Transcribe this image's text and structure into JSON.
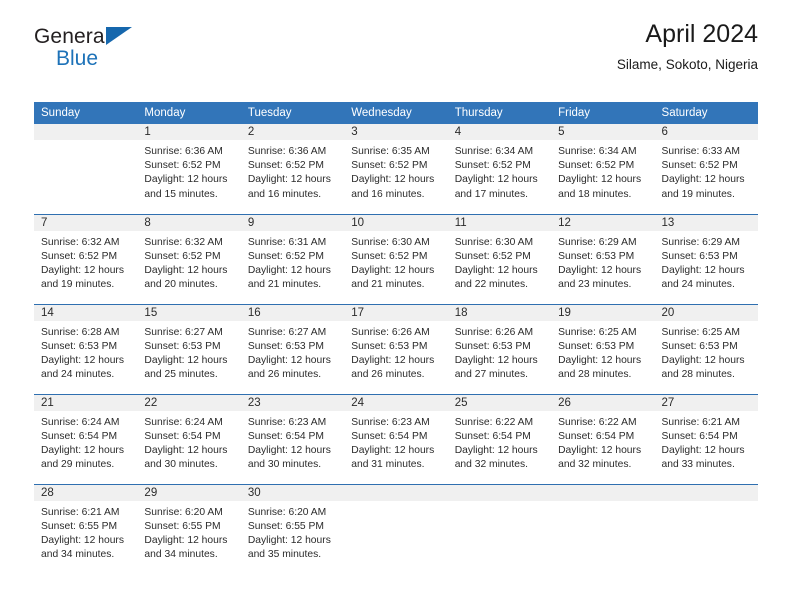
{
  "branding": {
    "logo_text_primary": "General",
    "logo_text_secondary": "Blue",
    "logo_icon": "triangle-icon",
    "accent_color": "#3275b9",
    "logo_blue": "#1d72b8"
  },
  "header": {
    "title": "April 2024",
    "subtitle": "Silame, Sokoto, Nigeria"
  },
  "calendar": {
    "weekday_headers": [
      "Sunday",
      "Monday",
      "Tuesday",
      "Wednesday",
      "Thursday",
      "Friday",
      "Saturday"
    ],
    "weeks": [
      [
        {
          "day": "",
          "lines": []
        },
        {
          "day": "1",
          "lines": [
            "Sunrise: 6:36 AM",
            "Sunset: 6:52 PM",
            "Daylight: 12 hours",
            "and 15 minutes."
          ]
        },
        {
          "day": "2",
          "lines": [
            "Sunrise: 6:36 AM",
            "Sunset: 6:52 PM",
            "Daylight: 12 hours",
            "and 16 minutes."
          ]
        },
        {
          "day": "3",
          "lines": [
            "Sunrise: 6:35 AM",
            "Sunset: 6:52 PM",
            "Daylight: 12 hours",
            "and 16 minutes."
          ]
        },
        {
          "day": "4",
          "lines": [
            "Sunrise: 6:34 AM",
            "Sunset: 6:52 PM",
            "Daylight: 12 hours",
            "and 17 minutes."
          ]
        },
        {
          "day": "5",
          "lines": [
            "Sunrise: 6:34 AM",
            "Sunset: 6:52 PM",
            "Daylight: 12 hours",
            "and 18 minutes."
          ]
        },
        {
          "day": "6",
          "lines": [
            "Sunrise: 6:33 AM",
            "Sunset: 6:52 PM",
            "Daylight: 12 hours",
            "and 19 minutes."
          ]
        }
      ],
      [
        {
          "day": "7",
          "lines": [
            "Sunrise: 6:32 AM",
            "Sunset: 6:52 PM",
            "Daylight: 12 hours",
            "and 19 minutes."
          ]
        },
        {
          "day": "8",
          "lines": [
            "Sunrise: 6:32 AM",
            "Sunset: 6:52 PM",
            "Daylight: 12 hours",
            "and 20 minutes."
          ]
        },
        {
          "day": "9",
          "lines": [
            "Sunrise: 6:31 AM",
            "Sunset: 6:52 PM",
            "Daylight: 12 hours",
            "and 21 minutes."
          ]
        },
        {
          "day": "10",
          "lines": [
            "Sunrise: 6:30 AM",
            "Sunset: 6:52 PM",
            "Daylight: 12 hours",
            "and 21 minutes."
          ]
        },
        {
          "day": "11",
          "lines": [
            "Sunrise: 6:30 AM",
            "Sunset: 6:52 PM",
            "Daylight: 12 hours",
            "and 22 minutes."
          ]
        },
        {
          "day": "12",
          "lines": [
            "Sunrise: 6:29 AM",
            "Sunset: 6:53 PM",
            "Daylight: 12 hours",
            "and 23 minutes."
          ]
        },
        {
          "day": "13",
          "lines": [
            "Sunrise: 6:29 AM",
            "Sunset: 6:53 PM",
            "Daylight: 12 hours",
            "and 24 minutes."
          ]
        }
      ],
      [
        {
          "day": "14",
          "lines": [
            "Sunrise: 6:28 AM",
            "Sunset: 6:53 PM",
            "Daylight: 12 hours",
            "and 24 minutes."
          ]
        },
        {
          "day": "15",
          "lines": [
            "Sunrise: 6:27 AM",
            "Sunset: 6:53 PM",
            "Daylight: 12 hours",
            "and 25 minutes."
          ]
        },
        {
          "day": "16",
          "lines": [
            "Sunrise: 6:27 AM",
            "Sunset: 6:53 PM",
            "Daylight: 12 hours",
            "and 26 minutes."
          ]
        },
        {
          "day": "17",
          "lines": [
            "Sunrise: 6:26 AM",
            "Sunset: 6:53 PM",
            "Daylight: 12 hours",
            "and 26 minutes."
          ]
        },
        {
          "day": "18",
          "lines": [
            "Sunrise: 6:26 AM",
            "Sunset: 6:53 PM",
            "Daylight: 12 hours",
            "and 27 minutes."
          ]
        },
        {
          "day": "19",
          "lines": [
            "Sunrise: 6:25 AM",
            "Sunset: 6:53 PM",
            "Daylight: 12 hours",
            "and 28 minutes."
          ]
        },
        {
          "day": "20",
          "lines": [
            "Sunrise: 6:25 AM",
            "Sunset: 6:53 PM",
            "Daylight: 12 hours",
            "and 28 minutes."
          ]
        }
      ],
      [
        {
          "day": "21",
          "lines": [
            "Sunrise: 6:24 AM",
            "Sunset: 6:54 PM",
            "Daylight: 12 hours",
            "and 29 minutes."
          ]
        },
        {
          "day": "22",
          "lines": [
            "Sunrise: 6:24 AM",
            "Sunset: 6:54 PM",
            "Daylight: 12 hours",
            "and 30 minutes."
          ]
        },
        {
          "day": "23",
          "lines": [
            "Sunrise: 6:23 AM",
            "Sunset: 6:54 PM",
            "Daylight: 12 hours",
            "and 30 minutes."
          ]
        },
        {
          "day": "24",
          "lines": [
            "Sunrise: 6:23 AM",
            "Sunset: 6:54 PM",
            "Daylight: 12 hours",
            "and 31 minutes."
          ]
        },
        {
          "day": "25",
          "lines": [
            "Sunrise: 6:22 AM",
            "Sunset: 6:54 PM",
            "Daylight: 12 hours",
            "and 32 minutes."
          ]
        },
        {
          "day": "26",
          "lines": [
            "Sunrise: 6:22 AM",
            "Sunset: 6:54 PM",
            "Daylight: 12 hours",
            "and 32 minutes."
          ]
        },
        {
          "day": "27",
          "lines": [
            "Sunrise: 6:21 AM",
            "Sunset: 6:54 PM",
            "Daylight: 12 hours",
            "and 33 minutes."
          ]
        }
      ],
      [
        {
          "day": "28",
          "lines": [
            "Sunrise: 6:21 AM",
            "Sunset: 6:55 PM",
            "Daylight: 12 hours",
            "and 34 minutes."
          ]
        },
        {
          "day": "29",
          "lines": [
            "Sunrise: 6:20 AM",
            "Sunset: 6:55 PM",
            "Daylight: 12 hours",
            "and 34 minutes."
          ]
        },
        {
          "day": "30",
          "lines": [
            "Sunrise: 6:20 AM",
            "Sunset: 6:55 PM",
            "Daylight: 12 hours",
            "and 35 minutes."
          ]
        },
        {
          "day": "",
          "lines": []
        },
        {
          "day": "",
          "lines": []
        },
        {
          "day": "",
          "lines": []
        },
        {
          "day": "",
          "lines": []
        }
      ]
    ]
  }
}
